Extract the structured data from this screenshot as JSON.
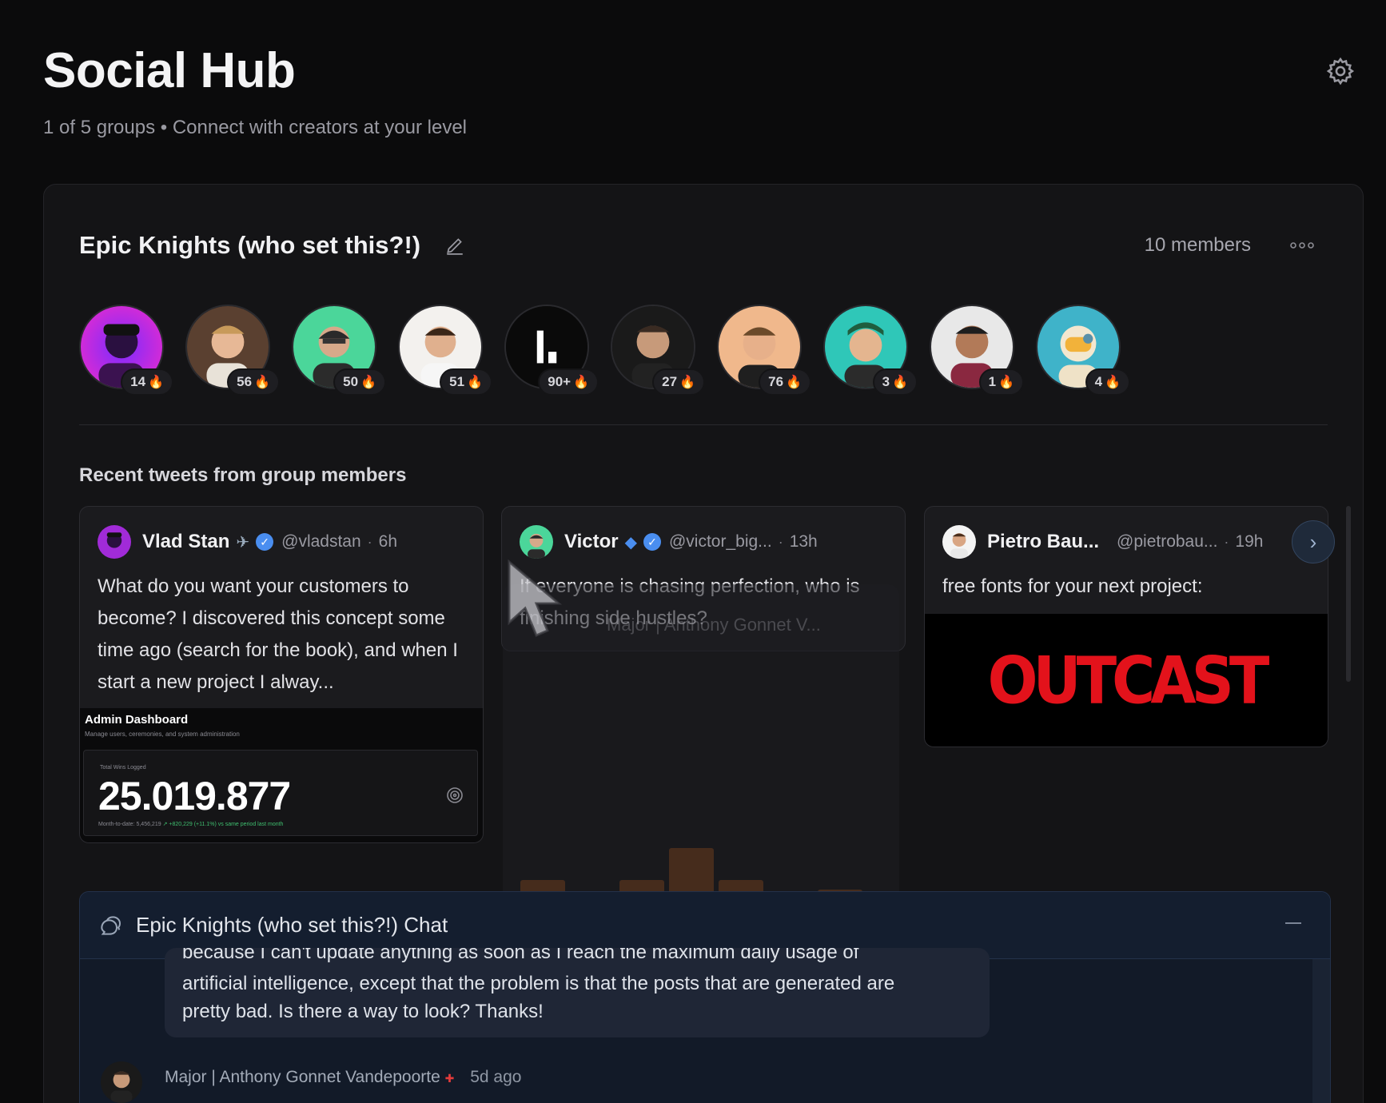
{
  "header": {
    "title": "Social Hub",
    "subtitle": "1 of 5 groups • Connect with creators at your level"
  },
  "group": {
    "name": "Epic Knights (who set this?!)",
    "members_label": "10 members",
    "avatars": [
      {
        "streak": "14"
      },
      {
        "streak": "56"
      },
      {
        "streak": "50"
      },
      {
        "streak": "51"
      },
      {
        "streak": "90+"
      },
      {
        "streak": "27"
      },
      {
        "streak": "76"
      },
      {
        "streak": "3"
      },
      {
        "streak": "1"
      },
      {
        "streak": "4"
      }
    ],
    "hover_name": "Major | Anthony Gonnet V...",
    "recent_label": "Recent tweets from group members"
  },
  "tweets": [
    {
      "name": "Vlad Stan",
      "handle": "@vladstan",
      "time": "6h",
      "text": "What do you want your customers to become? I discovered this concept some time ago (search for the book), and when I start a new project I alway...",
      "media": {
        "title": "Admin Dashboard",
        "subtitle": "Manage users, ceremonies, and system administration",
        "label": "Total Wins Logged",
        "number": "25.019.877",
        "foot": "Month-to-date: 5,456,219",
        "foot_green": "↗ +820,229 (+11.1%) vs same period last month"
      }
    },
    {
      "name": "Victor",
      "handle": "@victor_big...",
      "time": "13h",
      "text": "If everyone is chasing perfection, who is finishing side hustles?"
    },
    {
      "name": "Pietro Bau...",
      "handle": "@pietrobau...",
      "time": "19h",
      "text": "free fonts for your next project:",
      "media_text": "OUTCAST"
    }
  ],
  "chat": {
    "title": "Epic Knights (who set this?!) Chat",
    "bubble_partial": "because I can't update anything as soon as I reach the maximum daily usage of",
    "bubble_line2": "artificial intelligence, except that the problem is that the posts that are generated are",
    "bubble_line3": "pretty bad. Is there a way to look? Thanks!",
    "next_author": "Major | Anthony Gonnet Vandepoorte",
    "next_time": "5d ago"
  }
}
